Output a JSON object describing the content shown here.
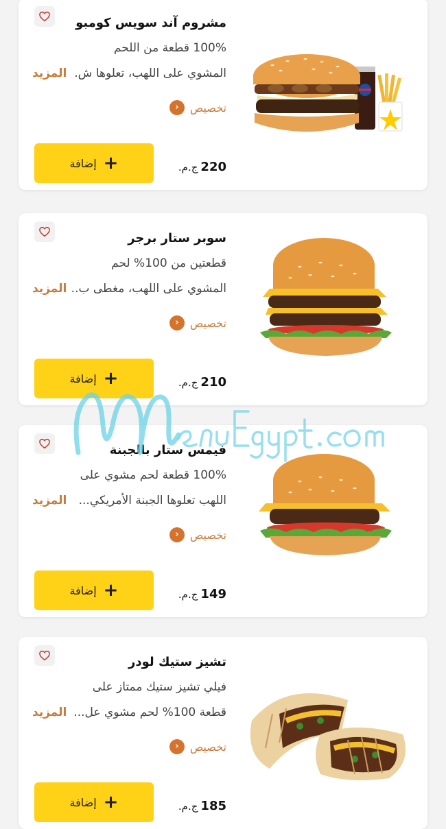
{
  "ui": {
    "more_label": "المزيد",
    "customize_label": "تخصيص",
    "add_label": "إضافة",
    "currency": "ج.م.",
    "add_icon": "plus-icon",
    "fav_icon": "heart-icon",
    "customize_icon": "chevron-left-icon",
    "accent_color": "#ffd117",
    "link_color": "#c97a3a"
  },
  "watermark": "MenuEgypt.com",
  "items": [
    {
      "title": "مشروم آند سويس كومبو",
      "desc_line1": "100% قطعة من اللحم",
      "desc_line2": "المشوي على اللهب، تعلوها ش.",
      "price": "220"
    },
    {
      "title": "سوبر ستار برجر",
      "desc_line1": "قطعتين من 100% لحم",
      "desc_line2": "المشوي على اللهب، مغطى ب..",
      "price": "210"
    },
    {
      "title": "فيمس ستار بالجبنة",
      "desc_line1": "100% قطعة لحم مشوي على",
      "desc_line2": "اللهب تعلوها الجبنة الأمريكي...",
      "price": "149"
    },
    {
      "title": "تشيز ستيك لودر",
      "desc_line1": "فيلي تشيز ستيك ممتاز على",
      "desc_line2": "قطعة 100% لحم مشوي عل...",
      "price": "185"
    }
  ]
}
